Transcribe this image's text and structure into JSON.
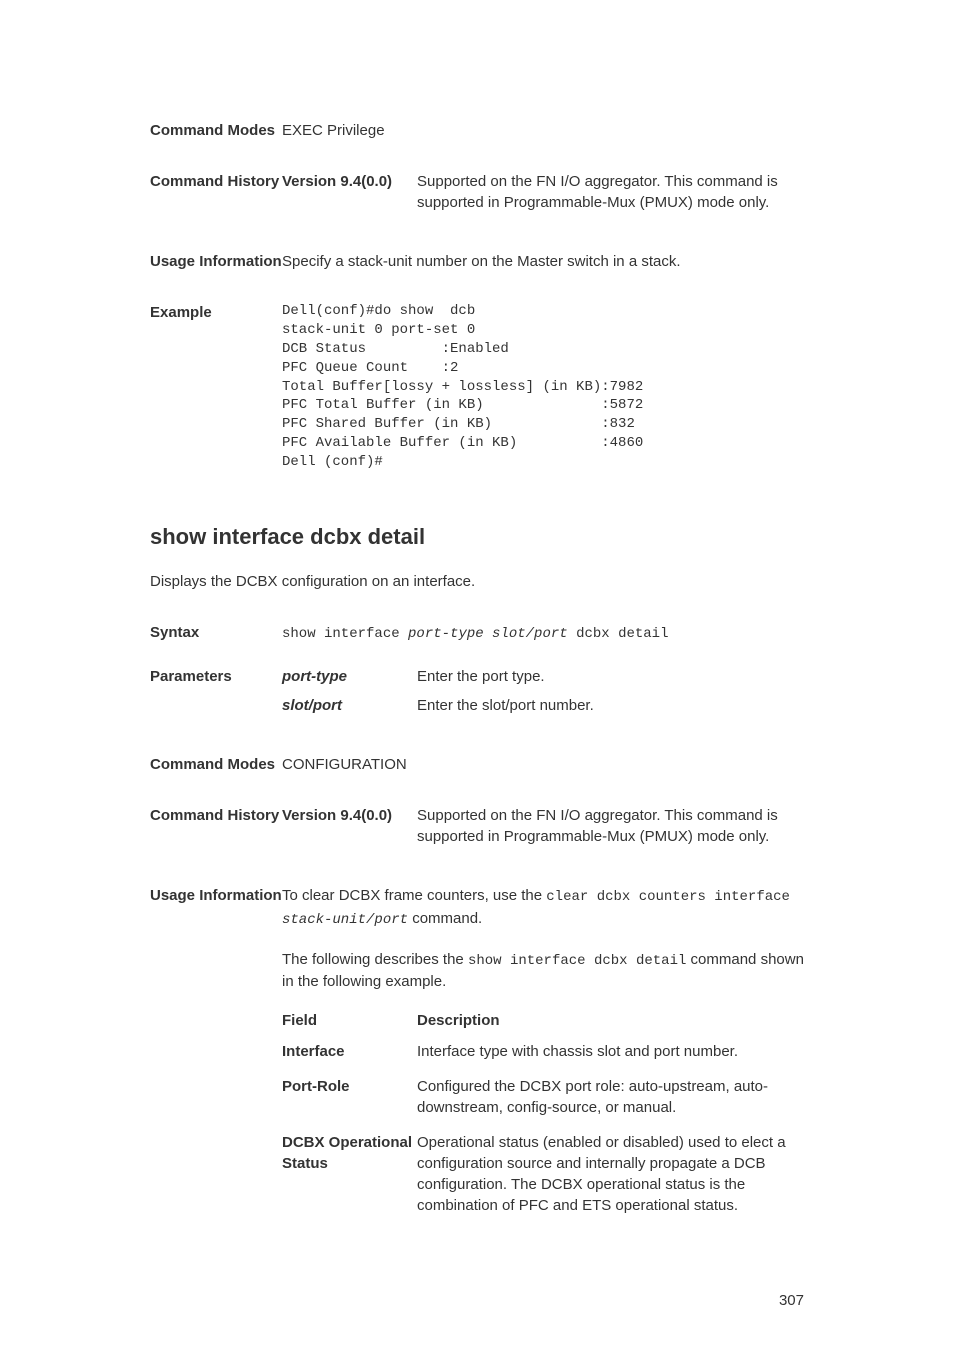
{
  "sec1": {
    "cmd_modes_label": "Command Modes",
    "cmd_modes_value": "EXEC Privilege",
    "cmd_history_label": "Command History",
    "version_label": "Version 9.4(0.0)",
    "version_desc": "Supported on the FN I/O aggregator. This command is supported in Programmable-Mux (PMUX) mode only.",
    "usage_label": "Usage Information",
    "usage_value": "Specify a stack-unit number on the Master switch in a stack.",
    "example_label": "Example",
    "example_code": "Dell(conf)#do show  dcb\nstack-unit 0 port-set 0\nDCB Status         :Enabled\nPFC Queue Count    :2\nTotal Buffer[lossy + lossless] (in KB):7982\nPFC Total Buffer (in KB)              :5872\nPFC Shared Buffer (in KB)             :832\nPFC Available Buffer (in KB)          :4860\nDell (conf)#"
  },
  "sec2": {
    "title": "show interface dcbx detail",
    "desc": "Displays the DCBX configuration on an interface.",
    "syntax_label": "Syntax",
    "syntax_prefix": "show interface ",
    "syntax_italic": "port-type slot/port",
    "syntax_suffix": " dcbx detail",
    "params_label": "Parameters",
    "param1_name": "port-type",
    "param1_desc": "Enter the port type.",
    "param2_name": "slot/port",
    "param2_desc": "Enter the slot/port number.",
    "cmd_modes_label": "Command Modes",
    "cmd_modes_value": "CONFIGURATION",
    "cmd_history_label": "Command History",
    "version_label": "Version 9.4(0.0)",
    "version_desc": "Supported on the FN I/O aggregator. This command is supported in Programmable-Mux (PMUX) mode only.",
    "usage_label": "Usage Information",
    "usage_p1_pre": "To clear DCBX frame counters, use the ",
    "usage_p1_code1": "clear dcbx counters interface ",
    "usage_p1_code2": "stack-unit/port",
    "usage_p1_post": " command.",
    "usage_p2_pre": "The following describes the ",
    "usage_p2_code": "show interface dcbx detail",
    "usage_p2_post": " command shown in the following example.",
    "th_field": "Field",
    "th_desc": "Description",
    "rows": [
      {
        "field": "Interface",
        "desc": "Interface type with chassis slot and port number."
      },
      {
        "field": "Port-Role",
        "desc": "Configured the DCBX port role: auto-upstream, auto-downstream, config-source, or manual."
      },
      {
        "field": "DCBX Operational Status",
        "desc": "Operational status (enabled or disabled) used to elect a configuration source and internally propagate a DCB configuration. The DCBX operational status is the combination of PFC and ETS operational status."
      }
    ]
  },
  "page_number": "307"
}
